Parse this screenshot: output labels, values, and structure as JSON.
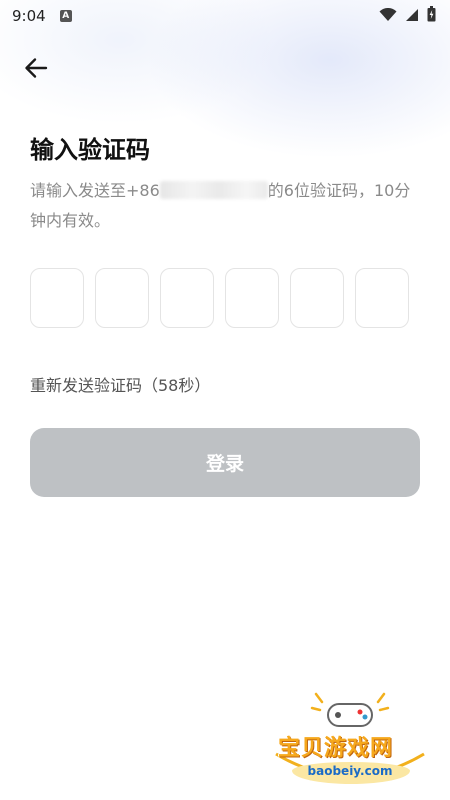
{
  "status_bar": {
    "time": "9:04",
    "notification_icon": "A",
    "icons": [
      "wifi-icon",
      "signal-icon",
      "battery-icon"
    ]
  },
  "header": {
    "back_icon": "arrow-left-icon"
  },
  "title": "输入验证码",
  "subtitle": {
    "prefix": "请输入发送至+86",
    "suffix": "的6位验证码，10分钟内有效。"
  },
  "code_inputs": [
    "",
    "",
    "",
    "",
    "",
    ""
  ],
  "resend": {
    "label": "重新发送验证码（58秒）"
  },
  "login_button": {
    "label": "登录",
    "color": "#bec1c4"
  },
  "watermark": {
    "name": "宝贝游戏网",
    "url": "baobeiy.com"
  }
}
